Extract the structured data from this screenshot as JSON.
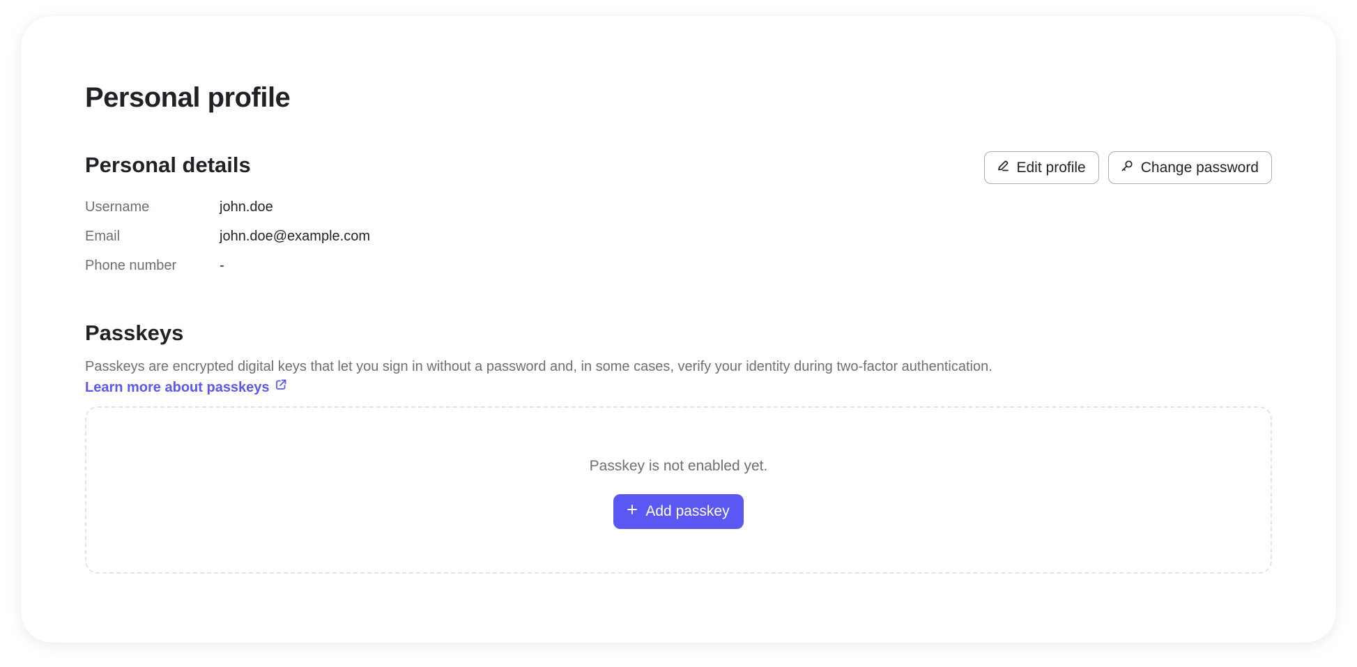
{
  "page": {
    "title": "Personal profile"
  },
  "details": {
    "title": "Personal details",
    "edit_label": "Edit profile",
    "change_password_label": "Change password",
    "fields": [
      {
        "label": "Username",
        "value": "john.doe"
      },
      {
        "label": "Email",
        "value": "john.doe@example.com"
      },
      {
        "label": "Phone number",
        "value": "-"
      }
    ]
  },
  "passkeys": {
    "title": "Passkeys",
    "description": "Passkeys are encrypted digital keys that let you sign in without a password and, in some cases, verify your identity during two-factor authentication.",
    "learn_more": "Learn more about passkeys",
    "empty_text": "Passkey is not enabled yet.",
    "add_label": "Add passkey"
  },
  "icons": {
    "edit": "pen-icon",
    "password": "key-icon",
    "external": "external-link-icon",
    "add": "plus-icon"
  },
  "colors": {
    "accent": "#5a57f2",
    "text_primary": "#1f2126",
    "text_secondary": "#6b6f78",
    "border": "#a9abb3",
    "dashed_border": "#e3e4e8"
  }
}
